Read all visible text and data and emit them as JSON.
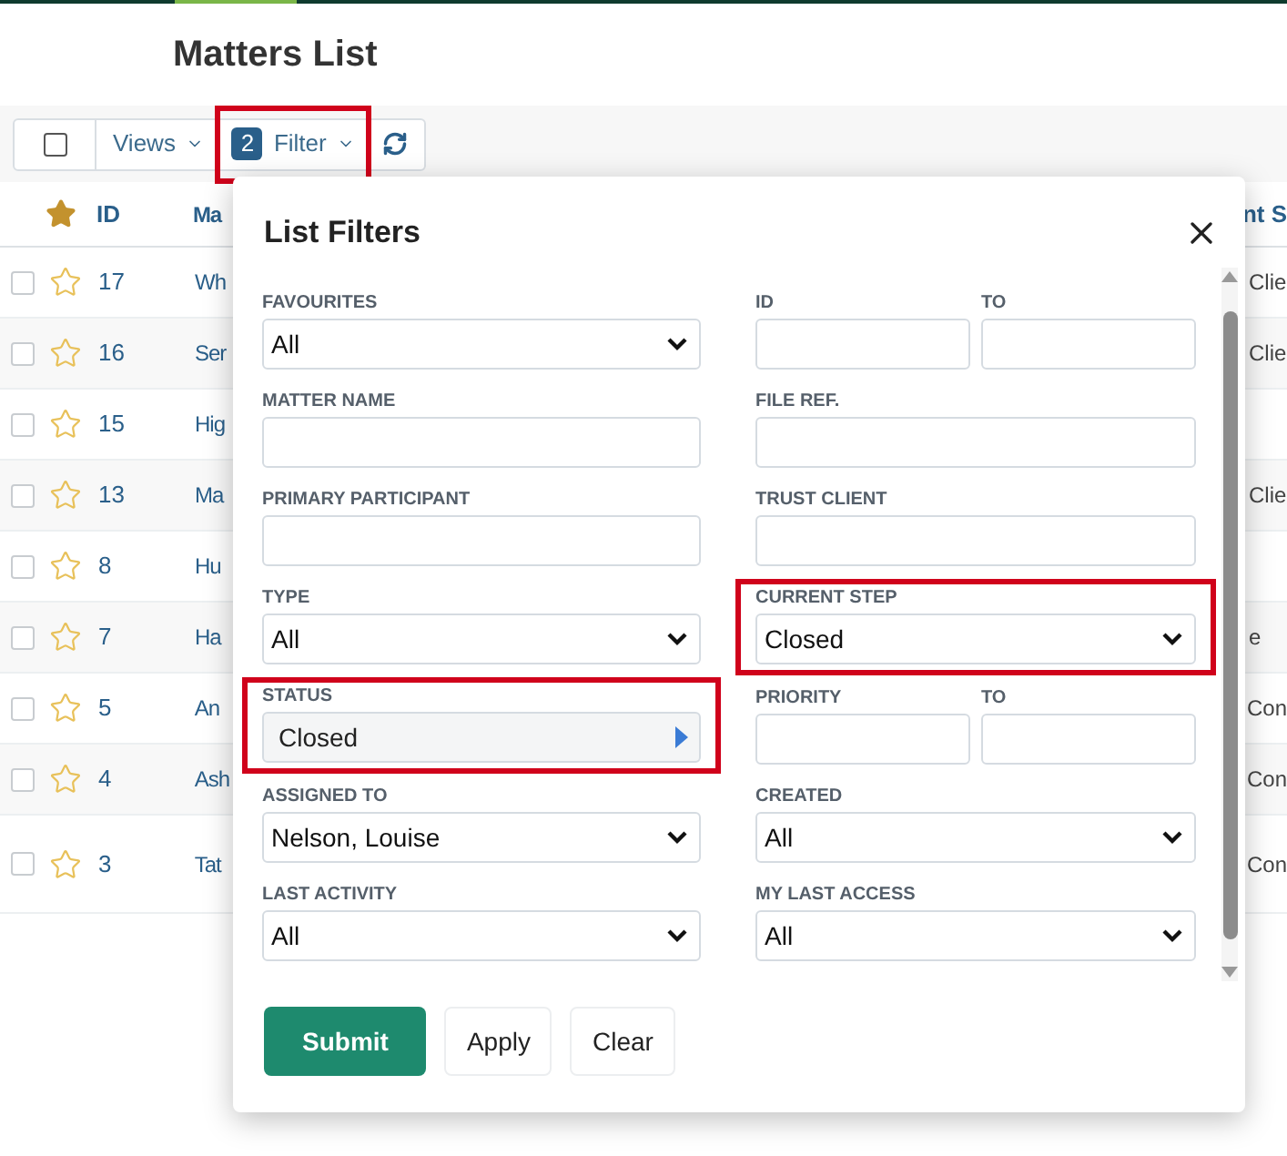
{
  "page": {
    "title": "Matters List"
  },
  "toolbar": {
    "select_all_checked": false,
    "views_label": "Views",
    "filter_count": "2",
    "filter_label": "Filter",
    "filter_highlighted": true
  },
  "table": {
    "columns": [
      "ID",
      "Ma",
      "nt S"
    ],
    "rows": [
      {
        "id": "17",
        "name": "Wh",
        "column_3": "Clie",
        "checked": false,
        "favourite": false
      },
      {
        "id": "16",
        "name": "Ser",
        "column_3": "Clie",
        "checked": false,
        "favourite": false
      },
      {
        "id": "15",
        "name": "Hig",
        "checked": false,
        "favourite": false
      },
      {
        "id": "13",
        "name": "Ma",
        "column_3": "Clie",
        "checked": false,
        "favourite": false
      },
      {
        "id": "8",
        "name": "Hu",
        "checked": false,
        "favourite": false
      },
      {
        "id": "7",
        "name": "Ha",
        "column_3": "e",
        "checked": false,
        "favourite": false
      },
      {
        "id": "5",
        "name": "An",
        "column_3": "Con",
        "checked": false,
        "favourite": false
      },
      {
        "id": "4",
        "name": "Ash",
        "column_3": "Con",
        "checked": false,
        "favourite": false
      },
      {
        "id": "3",
        "name": "Tat",
        "column_3": "Con",
        "checked": false,
        "favourite": false
      }
    ]
  },
  "dialog": {
    "title": "List Filters",
    "left_fields": [
      {
        "kind": "select",
        "label": "FAVOURITES",
        "value": "All",
        "highlighted": false
      },
      {
        "kind": "text",
        "label": "MATTER NAME",
        "highlighted": false
      },
      {
        "kind": "text",
        "label": "PRIMARY PARTICIPANT",
        "highlighted": false
      },
      {
        "kind": "select",
        "label": "TYPE",
        "value": "All",
        "highlighted": false
      },
      {
        "kind": "picker",
        "label": "STATUS",
        "value": "Closed",
        "highlighted": true
      },
      {
        "kind": "select",
        "label": "ASSIGNED TO",
        "value": "Nelson, Louise",
        "highlighted": false
      },
      {
        "kind": "select",
        "label": "LAST ACTIVITY",
        "value": "All",
        "highlighted": false
      }
    ],
    "right_fields": [
      {
        "kind": "range",
        "label": "ID",
        "to_label": "TO",
        "highlighted": false
      },
      {
        "kind": "text",
        "label": "FILE REF.",
        "highlighted": false
      },
      {
        "kind": "text",
        "label": "TRUST CLIENT",
        "highlighted": false
      },
      {
        "kind": "select",
        "label": "CURRENT STEP",
        "value": "Closed",
        "highlighted": true
      },
      {
        "kind": "range",
        "label": "PRIORITY",
        "to_label": "TO",
        "highlighted": false
      },
      {
        "kind": "select",
        "label": "CREATED",
        "value": "All",
        "highlighted": false
      },
      {
        "kind": "select",
        "label": "MY LAST ACCESS",
        "value": "All",
        "highlighted": false
      }
    ],
    "buttons": [
      {
        "label": "Submit",
        "primary": true
      },
      {
        "label": "Apply",
        "primary": false
      },
      {
        "label": "Clear",
        "primary": false
      }
    ]
  }
}
